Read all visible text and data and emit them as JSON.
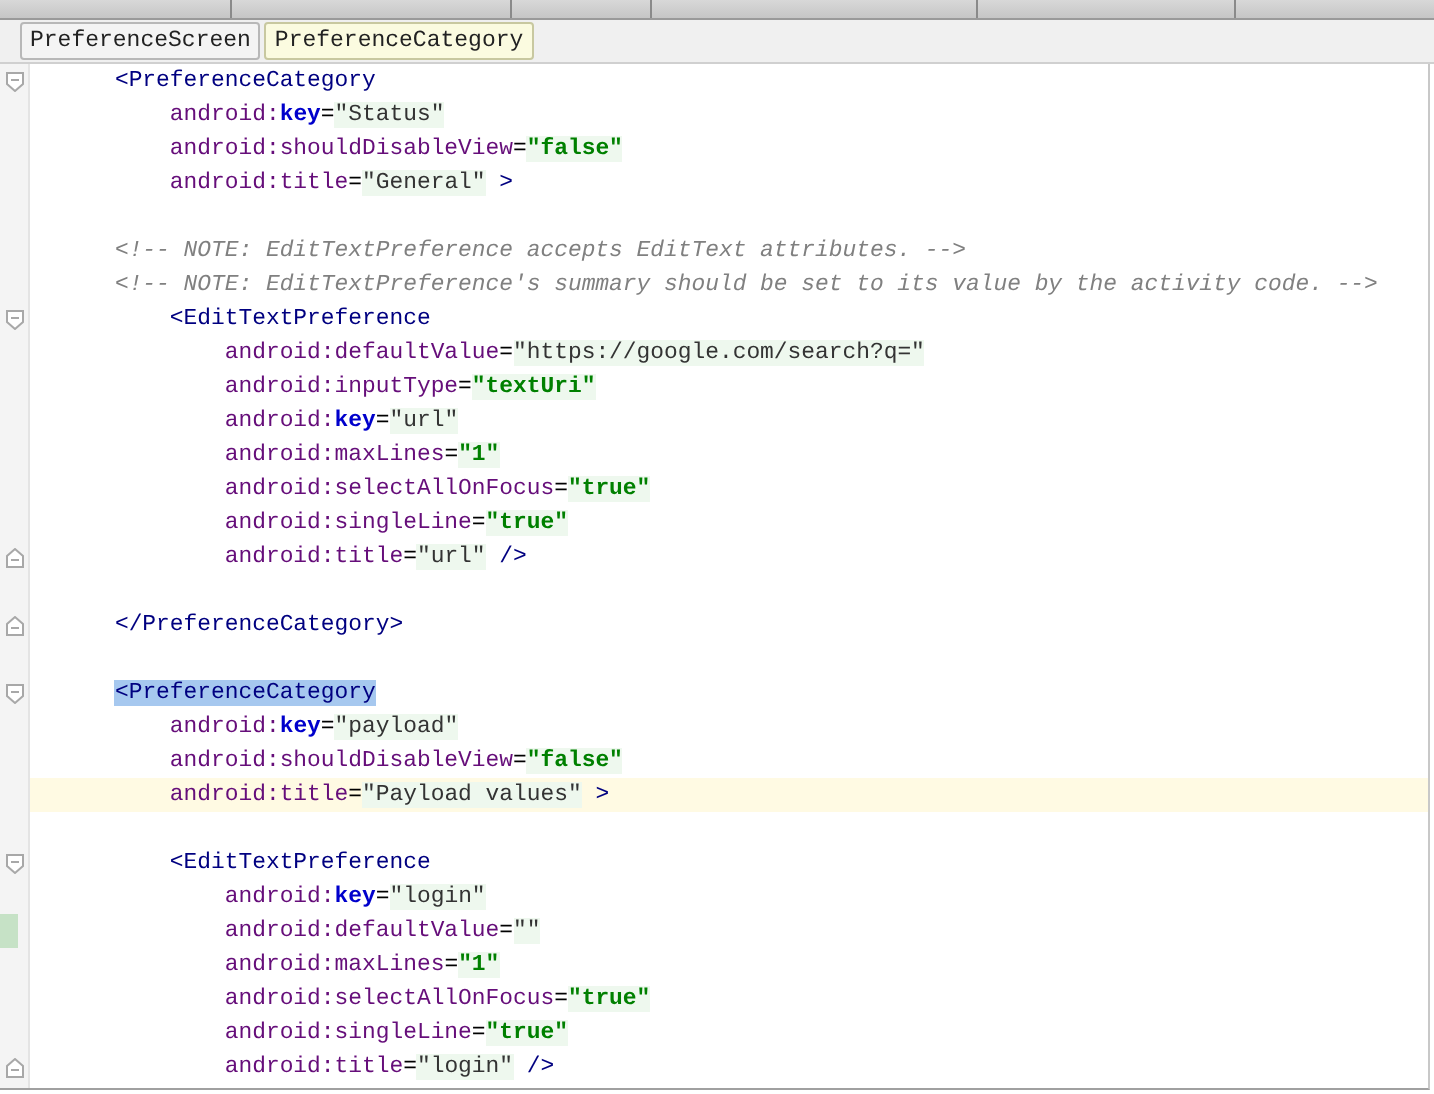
{
  "breadcrumbs": [
    {
      "label": "PreferenceScreen",
      "selected": false
    },
    {
      "label": "PreferenceCategory",
      "selected": true
    }
  ],
  "lines": [
    {
      "fold_marker": {
        "kind": "start"
      },
      "current": false,
      "changed": false,
      "tokens": [
        {
          "kind": "tag",
          "text": "    <PreferenceCategory"
        }
      ]
    },
    {
      "current": false,
      "changed": false,
      "tokens": [
        {
          "kind": "ns",
          "text": "        android:"
        },
        {
          "kind": "attr",
          "text": "key"
        },
        {
          "kind": "punct",
          "text": "="
        },
        {
          "kind": "string",
          "text": "\"Status\""
        }
      ]
    },
    {
      "current": false,
      "changed": false,
      "tokens": [
        {
          "kind": "ns",
          "text": "        android:shouldDisableView"
        },
        {
          "kind": "punct",
          "text": "="
        },
        {
          "kind": "value",
          "text": "\"false\""
        }
      ]
    },
    {
      "current": false,
      "changed": false,
      "tokens": [
        {
          "kind": "ns",
          "text": "        android:title"
        },
        {
          "kind": "punct",
          "text": "="
        },
        {
          "kind": "string",
          "text": "\"General\""
        },
        {
          "kind": "tag",
          "text": " >"
        }
      ]
    },
    {
      "current": false,
      "changed": false
    },
    {
      "current": false,
      "changed": false,
      "tokens": [
        {
          "kind": "comment",
          "text": "    <!-- NOTE: EditTextPreference accepts EditText attributes. -->"
        }
      ]
    },
    {
      "current": false,
      "changed": false,
      "tokens": [
        {
          "kind": "comment",
          "text": "    <!-- NOTE: EditTextPreference's summary should be set to its value by the activity code. -->"
        }
      ]
    },
    {
      "fold_marker": {
        "kind": "start"
      },
      "current": false,
      "changed": false,
      "tokens": [
        {
          "kind": "tag",
          "text": "        <EditTextPreference"
        }
      ]
    },
    {
      "current": false,
      "changed": false,
      "tokens": [
        {
          "kind": "ns",
          "text": "            android:defaultValue"
        },
        {
          "kind": "punct",
          "text": "="
        },
        {
          "kind": "string",
          "text": "\"https://google.com/search?q=\""
        }
      ]
    },
    {
      "current": false,
      "changed": false,
      "tokens": [
        {
          "kind": "ns",
          "text": "            android:inputType"
        },
        {
          "kind": "punct",
          "text": "="
        },
        {
          "kind": "value",
          "text": "\"textUri\""
        }
      ]
    },
    {
      "current": false,
      "changed": false,
      "tokens": [
        {
          "kind": "ns",
          "text": "            android:"
        },
        {
          "kind": "attr",
          "text": "key"
        },
        {
          "kind": "punct",
          "text": "="
        },
        {
          "kind": "string",
          "text": "\"url\""
        }
      ]
    },
    {
      "current": false,
      "changed": false,
      "tokens": [
        {
          "kind": "ns",
          "text": "            android:maxLines"
        },
        {
          "kind": "punct",
          "text": "="
        },
        {
          "kind": "value",
          "text": "\"1\""
        }
      ]
    },
    {
      "current": false,
      "changed": false,
      "tokens": [
        {
          "kind": "ns",
          "text": "            android:selectAllOnFocus"
        },
        {
          "kind": "punct",
          "text": "="
        },
        {
          "kind": "value",
          "text": "\"true\""
        }
      ]
    },
    {
      "current": false,
      "changed": false,
      "tokens": [
        {
          "kind": "ns",
          "text": "            android:singleLine"
        },
        {
          "kind": "punct",
          "text": "="
        },
        {
          "kind": "value",
          "text": "\"true\""
        }
      ]
    },
    {
      "fold_marker": {
        "kind": "end"
      },
      "current": false,
      "changed": false,
      "tokens": [
        {
          "kind": "ns",
          "text": "            android:title"
        },
        {
          "kind": "punct",
          "text": "="
        },
        {
          "kind": "string",
          "text": "\"url\""
        },
        {
          "kind": "tag",
          "text": " />"
        }
      ]
    },
    {
      "current": false,
      "changed": false
    },
    {
      "fold_marker": {
        "kind": "end"
      },
      "current": false,
      "changed": false,
      "tokens": [
        {
          "kind": "tag",
          "text": "    </PreferenceCategory>"
        }
      ]
    },
    {
      "current": false,
      "changed": false
    },
    {
      "fold_marker": {
        "kind": "start"
      },
      "current": false,
      "changed": false,
      "tokens": [
        {
          "kind": "tag",
          "text": "    <PreferenceCategory",
          "selected": true
        }
      ]
    },
    {
      "current": false,
      "changed": false,
      "tokens": [
        {
          "kind": "ns",
          "text": "        android:"
        },
        {
          "kind": "attr",
          "text": "key"
        },
        {
          "kind": "punct",
          "text": "="
        },
        {
          "kind": "string",
          "text": "\"payload\""
        }
      ]
    },
    {
      "current": false,
      "changed": false,
      "tokens": [
        {
          "kind": "ns",
          "text": "        android:shouldDisableView"
        },
        {
          "kind": "punct",
          "text": "="
        },
        {
          "kind": "value",
          "text": "\"false\""
        }
      ]
    },
    {
      "current": true,
      "changed": false,
      "tokens": [
        {
          "kind": "ns",
          "text": "        android:title"
        },
        {
          "kind": "punct",
          "text": "="
        },
        {
          "kind": "string",
          "text": "\"Payload values\""
        },
        {
          "kind": "tag",
          "text": " >"
        }
      ]
    },
    {
      "current": false,
      "changed": false
    },
    {
      "fold_marker": {
        "kind": "start"
      },
      "current": false,
      "changed": false,
      "tokens": [
        {
          "kind": "tag",
          "text": "        <EditTextPreference"
        }
      ]
    },
    {
      "current": false,
      "changed": false,
      "tokens": [
        {
          "kind": "ns",
          "text": "            android:"
        },
        {
          "kind": "attr",
          "text": "key"
        },
        {
          "kind": "punct",
          "text": "="
        },
        {
          "kind": "string",
          "text": "\"login\""
        }
      ]
    },
    {
      "current": false,
      "changed": true,
      "tokens": [
        {
          "kind": "ns",
          "text": "            android:defaultValue"
        },
        {
          "kind": "punct",
          "text": "="
        },
        {
          "kind": "string",
          "text": "\"\""
        }
      ]
    },
    {
      "current": false,
      "changed": false,
      "tokens": [
        {
          "kind": "ns",
          "text": "            android:maxLines"
        },
        {
          "kind": "punct",
          "text": "="
        },
        {
          "kind": "value",
          "text": "\"1\""
        }
      ]
    },
    {
      "current": false,
      "changed": false,
      "tokens": [
        {
          "kind": "ns",
          "text": "            android:selectAllOnFocus"
        },
        {
          "kind": "punct",
          "text": "="
        },
        {
          "kind": "value",
          "text": "\"true\""
        }
      ]
    },
    {
      "current": false,
      "changed": false,
      "tokens": [
        {
          "kind": "ns",
          "text": "            android:singleLine"
        },
        {
          "kind": "punct",
          "text": "="
        },
        {
          "kind": "value",
          "text": "\"true\""
        }
      ]
    },
    {
      "fold_marker": {
        "kind": "end"
      },
      "current": false,
      "changed": false,
      "tokens": [
        {
          "kind": "ns",
          "text": "            android:title"
        },
        {
          "kind": "punct",
          "text": "="
        },
        {
          "kind": "string",
          "text": "\"login\""
        },
        {
          "kind": "tag",
          "text": " />"
        }
      ]
    }
  ]
}
